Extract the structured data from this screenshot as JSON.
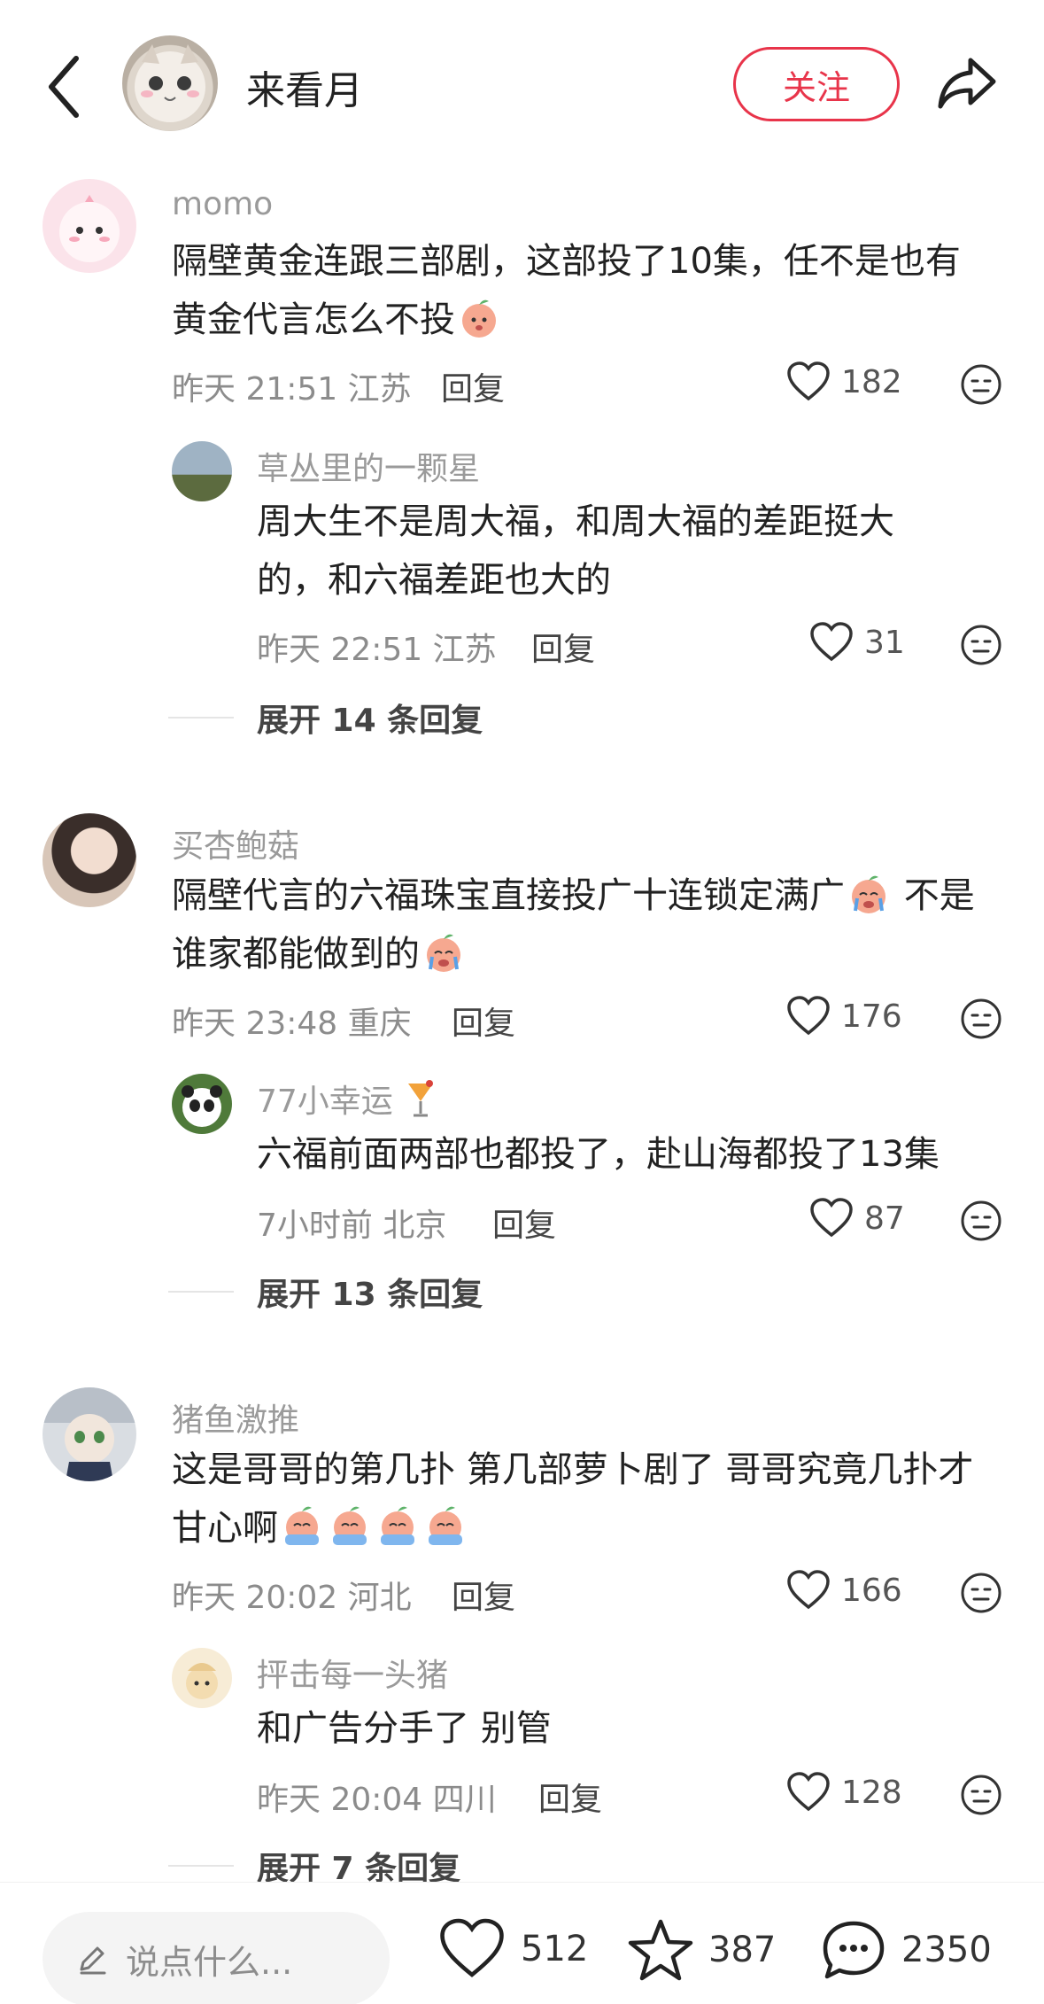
{
  "header": {
    "author_name": "来看月",
    "follow_label": "关注"
  },
  "comments": [
    {
      "name": "momo",
      "body_text": "隔壁黄金连跟三部剧，这部投了10集，任不是也有黄金代言怎么不投",
      "time_location": "昨天 21:51 江苏",
      "reply_label": "回复",
      "likes": "182",
      "reply": {
        "name": "草丛里的一颗星",
        "body_text": "周大生不是周大福，和周大福的差距挺大的，和六福差距也大的",
        "time_location": "昨天 22:51 江苏",
        "reply_label": "回复",
        "likes": "31"
      },
      "expand_label": "展开 14 条回复"
    },
    {
      "name": "买杏鲍菇",
      "body_text": "隔壁代言的六福珠宝直接投广十连锁定满广",
      "body_text_2": "不是谁家都能做到的",
      "time_location": "昨天 23:48 重庆",
      "reply_label": "回复",
      "likes": "176",
      "reply": {
        "name": "77小幸运",
        "body_text": "六福前面两部也都投了，赴山海都投了13集",
        "time_location": "7小时前 北京",
        "reply_label": "回复",
        "likes": "87"
      },
      "expand_label": "展开 13 条回复"
    },
    {
      "name": "猪鱼激推",
      "body_text": "这是哥哥的第几扑 第几部萝卜剧了 哥哥究竟几扑才甘心啊",
      "time_location": "昨天 20:02 河北",
      "reply_label": "回复",
      "likes": "166",
      "reply": {
        "name": "抨击每一头猪",
        "body_text": "和广告分手了 别管",
        "time_location": "昨天 20:04 四川",
        "reply_label": "回复",
        "likes": "128"
      },
      "expand_label": "展开 7 条回复"
    }
  ],
  "bottom_bar": {
    "input_placeholder": "说点什么...",
    "likes": "512",
    "stars": "387",
    "comments": "2350"
  },
  "colors": {
    "accent": "#e8344a",
    "muted_text": "#9a9a9a",
    "body_text": "#222222"
  }
}
